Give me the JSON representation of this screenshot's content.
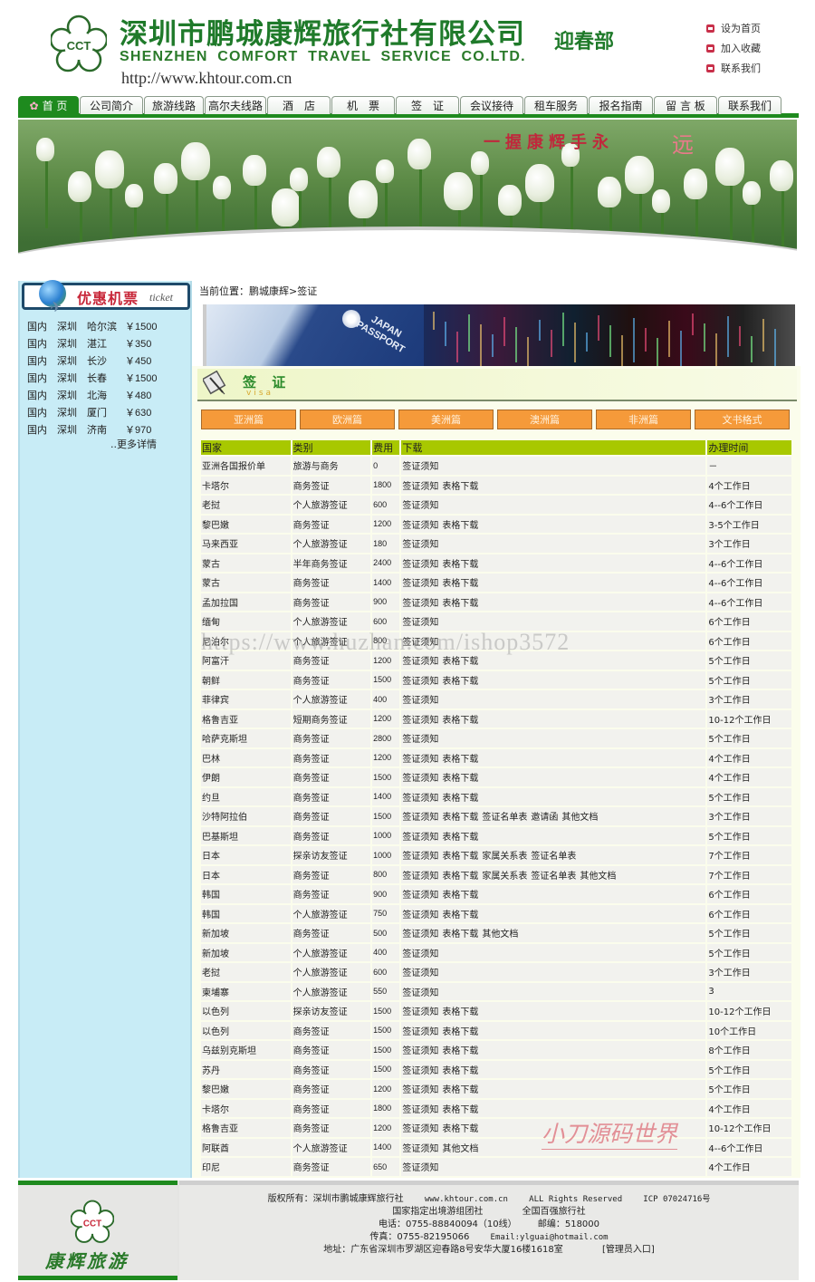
{
  "header": {
    "company_cn": "深圳市鹏城康辉旅行社有限公司",
    "company_sub": "迎春部",
    "company_en": "SHENZHEN COMFORT  TRAVEL SERVICE CO.LTD.",
    "url": "http://www.khtour.com.cn",
    "logo_text": "CCT",
    "quick_links": [
      "设为首页",
      "加入收藏",
      "联系我们"
    ]
  },
  "nav": {
    "items": [
      {
        "label": "首 页",
        "active": true
      },
      {
        "label": "公司简介"
      },
      {
        "label": "旅游线路"
      },
      {
        "label": "高尔夫线路"
      },
      {
        "label": "酒　店"
      },
      {
        "label": "机　票"
      },
      {
        "label": "签　证"
      },
      {
        "label": "会议接待"
      },
      {
        "label": "租车服务"
      },
      {
        "label": "报名指南"
      },
      {
        "label": "留 言 板"
      },
      {
        "label": "联系我们"
      }
    ]
  },
  "banner": {
    "slogan": "一握康辉手永",
    "slogan_end": "远"
  },
  "sidebar": {
    "title": "优惠机票",
    "title_en": "ticket",
    "tickets": [
      {
        "type": "国内",
        "from": "深圳",
        "to": "哈尔滨",
        "price": "￥1500"
      },
      {
        "type": "国内",
        "from": "深圳",
        "to": "湛江",
        "price": "￥350"
      },
      {
        "type": "国内",
        "from": "深圳",
        "to": "长沙",
        "price": "￥450"
      },
      {
        "type": "国内",
        "from": "深圳",
        "to": "长春",
        "price": "￥1500"
      },
      {
        "type": "国内",
        "from": "深圳",
        "to": "北海",
        "price": "￥480"
      },
      {
        "type": "国内",
        "from": "深圳",
        "to": "厦门",
        "price": "￥630"
      },
      {
        "type": "国内",
        "from": "深圳",
        "to": "济南",
        "price": "￥970"
      }
    ],
    "more": "..更多详情"
  },
  "main": {
    "breadcrumb": "当前位置：鹏城康辉>签证",
    "passport_text": "JAPAN PASSPORT",
    "section_title": "签 证",
    "section_title_en": "visa",
    "region_tabs": [
      "亚洲篇",
      "欧洲篇",
      "美洲篇",
      "澳洲篇",
      "非洲篇",
      "文书格式"
    ],
    "table": {
      "headers": [
        "国家",
        "类别",
        "费用",
        "下载",
        "办理时间"
      ],
      "rows": [
        {
          "country": "亚洲各国报价单",
          "type": "旅游与商务",
          "fee": "0",
          "docs": [
            "签证须知"
          ],
          "time": "－"
        },
        {
          "country": "卡塔尔",
          "type": "商务签证",
          "fee": "1800",
          "docs": [
            "签证须知",
            "表格下载"
          ],
          "time": "4个工作日"
        },
        {
          "country": "老挝",
          "type": "个人旅游签证",
          "fee": "600",
          "docs": [
            "签证须知"
          ],
          "time": "4--6个工作日"
        },
        {
          "country": "黎巴嫩",
          "type": "商务签证",
          "fee": "1200",
          "docs": [
            "签证须知",
            "表格下载"
          ],
          "time": "3-5个工作日"
        },
        {
          "country": "马来西亚",
          "type": "个人旅游签证",
          "fee": "180",
          "docs": [
            "签证须知"
          ],
          "time": "3个工作日"
        },
        {
          "country": "蒙古",
          "type": "半年商务签证",
          "fee": "2400",
          "docs": [
            "签证须知",
            "表格下载"
          ],
          "time": "4--6个工作日"
        },
        {
          "country": "蒙古",
          "type": "商务签证",
          "fee": "1400",
          "docs": [
            "签证须知",
            "表格下载"
          ],
          "time": "4--6个工作日"
        },
        {
          "country": "孟加拉国",
          "type": "商务签证",
          "fee": "900",
          "docs": [
            "签证须知",
            "表格下载"
          ],
          "time": "4--6个工作日"
        },
        {
          "country": "缅甸",
          "type": "个人旅游签证",
          "fee": "600",
          "docs": [
            "签证须知"
          ],
          "time": "6个工作日"
        },
        {
          "country": "尼泊尔",
          "type": "个人旅游签证",
          "fee": "800",
          "docs": [
            "签证须知"
          ],
          "time": "6个工作日"
        },
        {
          "country": "阿富汗",
          "type": "商务签证",
          "fee": "1200",
          "docs": [
            "签证须知",
            "表格下载"
          ],
          "time": "5个工作日"
        },
        {
          "country": "朝鲜",
          "type": "商务签证",
          "fee": "1500",
          "docs": [
            "签证须知",
            "表格下载"
          ],
          "time": "5个工作日"
        },
        {
          "country": "菲律宾",
          "type": "个人旅游签证",
          "fee": "400",
          "docs": [
            "签证须知"
          ],
          "time": "3个工作日"
        },
        {
          "country": "格鲁吉亚",
          "type": "短期商务签证",
          "fee": "1200",
          "docs": [
            "签证须知",
            "表格下载"
          ],
          "time": "10-12个工作日"
        },
        {
          "country": "哈萨克斯坦",
          "type": "商务签证",
          "fee": "2800",
          "docs": [
            "签证须知"
          ],
          "time": "5个工作日"
        },
        {
          "country": "巴林",
          "type": "商务签证",
          "fee": "1200",
          "docs": [
            "签证须知",
            "表格下载"
          ],
          "time": "4个工作日"
        },
        {
          "country": "伊朗",
          "type": "商务签证",
          "fee": "1500",
          "docs": [
            "签证须知",
            "表格下载"
          ],
          "time": "4个工作日"
        },
        {
          "country": "约旦",
          "type": "商务签证",
          "fee": "1400",
          "docs": [
            "签证须知",
            "表格下载"
          ],
          "time": "5个工作日"
        },
        {
          "country": "沙特阿拉伯",
          "type": "商务签证",
          "fee": "1500",
          "docs": [
            "签证须知",
            "表格下载",
            "签证名单表",
            "邀请函",
            "其他文档"
          ],
          "time": "3个工作日"
        },
        {
          "country": "巴基斯坦",
          "type": "商务签证",
          "fee": "1000",
          "docs": [
            "签证须知",
            "表格下载"
          ],
          "time": "5个工作日"
        },
        {
          "country": "日本",
          "type": "探亲访友签证",
          "fee": "1000",
          "docs": [
            "签证须知",
            "表格下载",
            "家属关系表",
            "签证名单表"
          ],
          "time": "7个工作日"
        },
        {
          "country": "日本",
          "type": "商务签证",
          "fee": "800",
          "docs": [
            "签证须知",
            "表格下载",
            "家属关系表",
            "签证名单表",
            "其他文档"
          ],
          "time": "7个工作日"
        },
        {
          "country": "韩国",
          "type": "商务签证",
          "fee": "900",
          "docs": [
            "签证须知",
            "表格下载"
          ],
          "time": "6个工作日"
        },
        {
          "country": "韩国",
          "type": "个人旅游签证",
          "fee": "750",
          "docs": [
            "签证须知",
            "表格下载"
          ],
          "time": "6个工作日"
        },
        {
          "country": "新加坡",
          "type": "商务签证",
          "fee": "500",
          "docs": [
            "签证须知",
            "表格下载",
            "其他文档"
          ],
          "time": "5个工作日"
        },
        {
          "country": "新加坡",
          "type": "个人旅游签证",
          "fee": "400",
          "docs": [
            "签证须知"
          ],
          "time": "5个工作日"
        },
        {
          "country": "老挝",
          "type": "个人旅游签证",
          "fee": "600",
          "docs": [
            "签证须知"
          ],
          "time": "3个工作日"
        },
        {
          "country": "柬埔寨",
          "type": "个人旅游签证",
          "fee": "550",
          "docs": [
            "签证须知"
          ],
          "time": "3"
        },
        {
          "country": "以色列",
          "type": "探亲访友签证",
          "fee": "1500",
          "docs": [
            "签证须知",
            "表格下载"
          ],
          "time": "10-12个工作日"
        },
        {
          "country": "以色列",
          "type": "商务签证",
          "fee": "1500",
          "docs": [
            "签证须知",
            "表格下载"
          ],
          "time": "10个工作日"
        },
        {
          "country": "乌兹别克斯坦",
          "type": "商务签证",
          "fee": "1500",
          "docs": [
            "签证须知",
            "表格下载"
          ],
          "time": "8个工作日"
        },
        {
          "country": "苏丹",
          "type": "商务签证",
          "fee": "1500",
          "docs": [
            "签证须知",
            "表格下载"
          ],
          "time": "5个工作日"
        },
        {
          "country": "黎巴嫩",
          "type": "商务签证",
          "fee": "1200",
          "docs": [
            "签证须知",
            "表格下载"
          ],
          "time": "5个工作日"
        },
        {
          "country": "卡塔尔",
          "type": "商务签证",
          "fee": "1800",
          "docs": [
            "签证须知",
            "表格下载"
          ],
          "time": "4个工作日"
        },
        {
          "country": "格鲁吉亚",
          "type": "商务签证",
          "fee": "1200",
          "docs": [
            "签证须知",
            "表格下载"
          ],
          "time": "10-12个工作日"
        },
        {
          "country": "阿联酋",
          "type": "个人旅游签证",
          "fee": "1400",
          "docs": [
            "签证须知",
            "其他文档"
          ],
          "time": "4--6个工作日"
        },
        {
          "country": "印尼",
          "type": "商务签证",
          "fee": "650",
          "docs": [
            "签证须知"
          ],
          "time": "4个工作日"
        }
      ]
    }
  },
  "watermarks": {
    "url": "https://www.huzhan.com/ishop3572",
    "brand": "小刀源码世界"
  },
  "footer": {
    "logo_text": "CCT",
    "brand": "康辉旅游",
    "copyright": "版权所有：深圳市鹏城康辉旅行社",
    "site": "www.khtour.com.cn",
    "rights": "ALL Rights Reserved",
    "icp": "ICP 07024716号",
    "tag1": "国家指定出境游组团社",
    "tag2": "全国百强旅行社",
    "phone": "电话：0755-88840094（10线）",
    "postcode": "邮编：518000",
    "fax": "传真：0755-82195066",
    "email": "Email:ylguai@hotmail.com",
    "address": "地址：广东省深圳市罗湖区迎春路8号安华大厦16楼1618室",
    "admin_link": "[管理员入口]"
  }
}
